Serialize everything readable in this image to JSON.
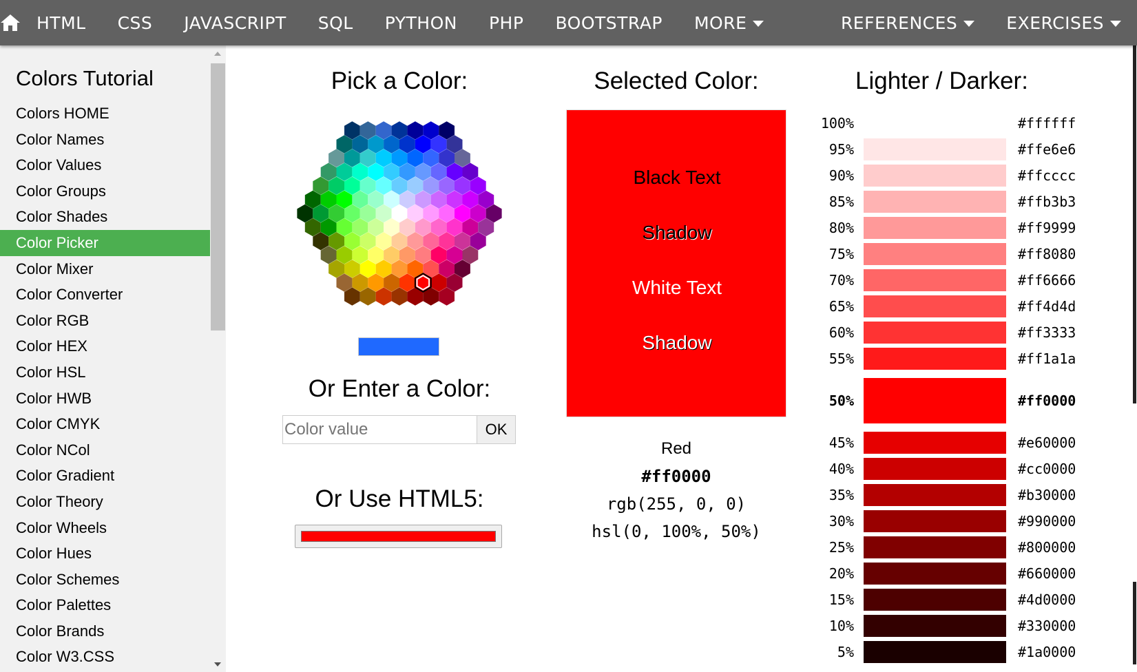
{
  "nav": {
    "home_icon": "home-icon",
    "items": [
      "HTML",
      "CSS",
      "JAVASCRIPT",
      "SQL",
      "PYTHON",
      "PHP",
      "BOOTSTRAP",
      "MORE"
    ],
    "references": "REFERENCES",
    "exercises": "EXERCISES"
  },
  "sidebar": {
    "title": "Colors Tutorial",
    "items": [
      "Colors HOME",
      "Color Names",
      "Color Values",
      "Color Groups",
      "Color Shades",
      "Color Picker",
      "Color Mixer",
      "Color Converter",
      "Color RGB",
      "Color HEX",
      "Color HSL",
      "Color HWB",
      "Color CMYK",
      "Color NCol",
      "Color Gradient",
      "Color Theory",
      "Color Wheels",
      "Color Hues",
      "Color Schemes",
      "Color Palettes",
      "Color Brands",
      "Color W3.CSS"
    ],
    "active_index": 5,
    "active_color": "#4caf50"
  },
  "picker": {
    "title": "Pick a Color:",
    "preview_color": "#1f69ff",
    "enter_title": "Or Enter a Color:",
    "input_placeholder": "Color value",
    "ok_label": "OK",
    "html5_title": "Or Use HTML5:",
    "html5_value": "#ff0000"
  },
  "selected": {
    "title": "Selected Color:",
    "color": "#ff0000",
    "black_text": "Black Text",
    "shadow1": "Shadow",
    "white_text": "White Text",
    "shadow2": "Shadow",
    "name": "Red",
    "hex": "#ff0000",
    "rgb": "rgb(255, 0, 0)",
    "hsl": "hsl(0, 100%, 50%)"
  },
  "shades": {
    "title": "Lighter / Darker:",
    "rows": [
      {
        "pct": "100%",
        "hex": "#ffffff"
      },
      {
        "pct": "95%",
        "hex": "#ffe6e6"
      },
      {
        "pct": "90%",
        "hex": "#ffcccc"
      },
      {
        "pct": "85%",
        "hex": "#ffb3b3"
      },
      {
        "pct": "80%",
        "hex": "#ff9999"
      },
      {
        "pct": "75%",
        "hex": "#ff8080"
      },
      {
        "pct": "70%",
        "hex": "#ff6666"
      },
      {
        "pct": "65%",
        "hex": "#ff4d4d"
      },
      {
        "pct": "60%",
        "hex": "#ff3333"
      },
      {
        "pct": "55%",
        "hex": "#ff1a1a"
      },
      {
        "pct": "50%",
        "hex": "#ff0000"
      },
      {
        "pct": "45%",
        "hex": "#e60000"
      },
      {
        "pct": "40%",
        "hex": "#cc0000"
      },
      {
        "pct": "35%",
        "hex": "#b30000"
      },
      {
        "pct": "30%",
        "hex": "#990000"
      },
      {
        "pct": "25%",
        "hex": "#800000"
      },
      {
        "pct": "20%",
        "hex": "#660000"
      },
      {
        "pct": "15%",
        "hex": "#4d0000"
      },
      {
        "pct": "10%",
        "hex": "#330000"
      },
      {
        "pct": "5%",
        "hex": "#1a0000"
      }
    ]
  }
}
